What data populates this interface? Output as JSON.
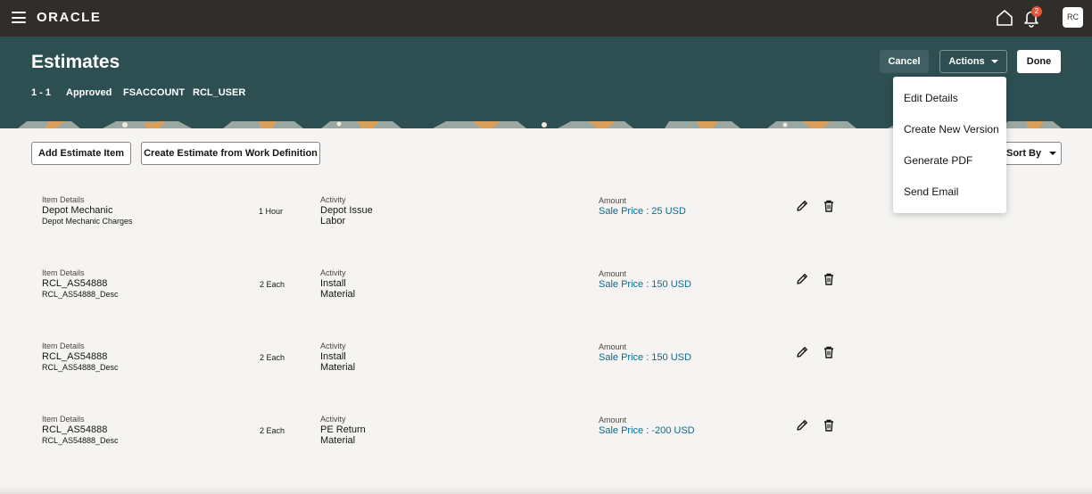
{
  "topbar": {
    "logo": "ORACLE",
    "notification_count": "2",
    "avatar_initials": "RC"
  },
  "header": {
    "title": "Estimates",
    "meta": [
      "1 - 1",
      "Approved",
      "FSACCOUNT",
      "RCL_USER"
    ],
    "cancel_label": "Cancel",
    "actions_label": "Actions",
    "done_label": "Done"
  },
  "toolbar": {
    "add_item_label": "Add Estimate Item",
    "create_from_wd_label": "Create Estimate from Work Definition",
    "sort_label": "Sort By"
  },
  "actions_menu": [
    "Edit Details",
    "Create New Version",
    "Generate PDF",
    "Send Email"
  ],
  "labels": {
    "item_details": "Item Details",
    "activity": "Activity",
    "amount": "Amount"
  },
  "items": [
    {
      "name": "Depot Mechanic",
      "desc": "Depot Mechanic Charges",
      "qty": "1 Hour",
      "activity1": "Depot Issue",
      "activity2": "Labor",
      "amount": "Sale Price : 25 USD"
    },
    {
      "name": "RCL_AS54888",
      "desc": "RCL_AS54888_Desc",
      "qty": "2 Each",
      "activity1": "Install",
      "activity2": "Material",
      "amount": "Sale Price : 150 USD"
    },
    {
      "name": "RCL_AS54888",
      "desc": "RCL_AS54888_Desc",
      "qty": "2 Each",
      "activity1": "Install",
      "activity2": "Material",
      "amount": "Sale Price : 150 USD"
    },
    {
      "name": "RCL_AS54888",
      "desc": "RCL_AS54888_Desc",
      "qty": "2 Each",
      "activity1": "PE Return",
      "activity2": "Material",
      "amount": "Sale Price : -200 USD"
    }
  ],
  "colors": {
    "topbar": "#312d2a",
    "header": "#2d4f52",
    "link": "#0b6a8f",
    "badge": "#e2563b"
  }
}
